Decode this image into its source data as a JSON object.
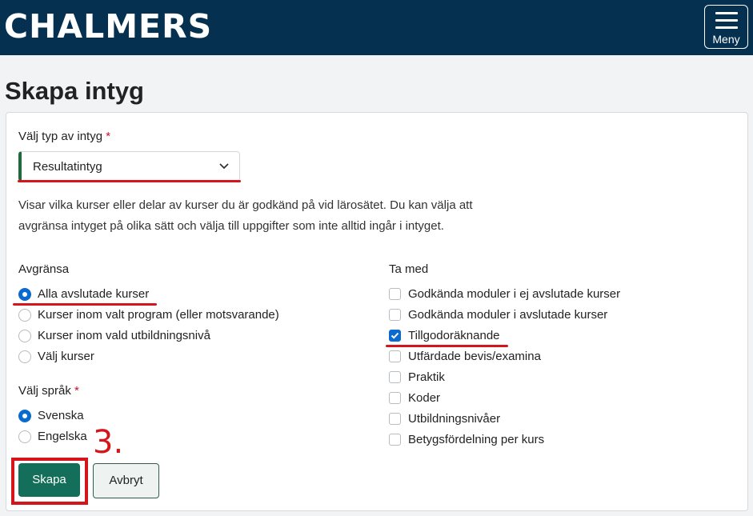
{
  "header": {
    "logo_text": "CHALMERS",
    "menu_label": "Meny"
  },
  "page_title": "Skapa intyg",
  "form": {
    "type_label": "Välj typ av intyg",
    "required_mark": "*",
    "type_value": "Resultatintyg",
    "description_line1": "Visar vilka kurser eller delar av kurser du är godkänd på vid lärosätet. Du kan välja att",
    "description_line2": "avgränsa intyget på olika sätt och välja till uppgifter som inte alltid ingår i intyget.",
    "limit": {
      "heading": "Avgränsa",
      "options": [
        {
          "label": "Alla avslutade kurser",
          "checked": true
        },
        {
          "label": "Kurser inom valt program (eller motsvarande)",
          "checked": false
        },
        {
          "label": "Kurser inom vald utbildningsnivå",
          "checked": false
        },
        {
          "label": "Välj kurser",
          "checked": false
        }
      ]
    },
    "language": {
      "heading": "Välj språk",
      "options": [
        {
          "label": "Svenska",
          "checked": true
        },
        {
          "label": "Engelska",
          "checked": false
        }
      ]
    },
    "include": {
      "heading": "Ta med",
      "options": [
        {
          "label": "Godkända moduler i ej avslutade kurser",
          "checked": false
        },
        {
          "label": "Godkända moduler i avslutade kurser",
          "checked": false
        },
        {
          "label": "Tillgodoräknande",
          "checked": true
        },
        {
          "label": "Utfärdade bevis/examina",
          "checked": false
        },
        {
          "label": "Praktik",
          "checked": false
        },
        {
          "label": "Koder",
          "checked": false
        },
        {
          "label": "Utbildningsnivåer",
          "checked": false
        },
        {
          "label": "Betygsfördelning per kurs",
          "checked": false
        }
      ]
    },
    "create_label": "Skapa",
    "cancel_label": "Avbryt"
  },
  "annotation": {
    "step_number": "3."
  },
  "colors": {
    "header_bg": "#05304f",
    "primary_button": "#136e5a",
    "accent_blue": "#0a6ad0",
    "annotation_red": "#d5151c"
  }
}
